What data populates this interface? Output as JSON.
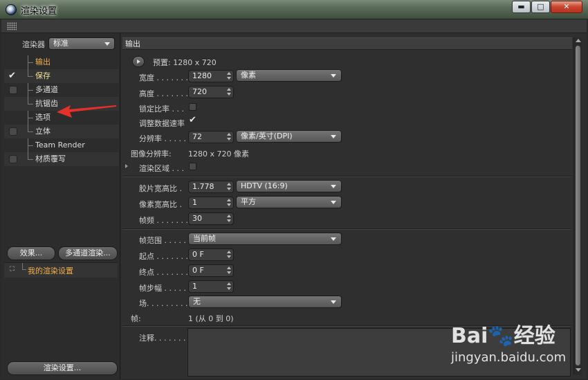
{
  "window": {
    "title": "渲染设置",
    "buttons": {
      "minimize": "▬",
      "maximize": "□",
      "close": "✕"
    }
  },
  "left": {
    "renderer_label": "渲染器",
    "renderer_value": "标准",
    "tree": [
      {
        "label": "输出",
        "checkbox": false,
        "checked": false,
        "active": true
      },
      {
        "label": "保存",
        "checkbox": true,
        "checked": true,
        "active": false
      },
      {
        "label": "多通道",
        "checkbox": true,
        "checked": false,
        "active": false
      },
      {
        "label": "抗锯齿",
        "checkbox": false,
        "checked": false,
        "active": false
      },
      {
        "label": "选项",
        "checkbox": false,
        "checked": false,
        "active": false
      },
      {
        "label": "立体",
        "checkbox": true,
        "checked": false,
        "active": false
      },
      {
        "label": "Team Render",
        "checkbox": false,
        "checked": false,
        "active": false
      },
      {
        "label": "材质覆写",
        "checkbox": true,
        "checked": false,
        "active": false
      }
    ],
    "effects_button": "效果...",
    "multipass_button": "多通道渲染...",
    "settings_item": "我的渲染设置",
    "render_settings_button": "渲染设置..."
  },
  "output": {
    "header": "输出",
    "preset": "预置: 1280 x 720",
    "width_label": "宽度 . . . . . . . .",
    "width_value": "1280",
    "unit_value": "像素",
    "height_label": "高度 . . . . . . . .",
    "height_value": "720",
    "lock_ratio_label": "锁定比率 . . .",
    "adapt_rate_label": "调整数据速率",
    "resolution_label": "分辨率 . . . . .",
    "resolution_value": "72",
    "resolution_unit": "像素/英寸(DPI)",
    "image_res_label": "图像分辨率:",
    "image_res_value": "1280 x 720 像素",
    "render_region_label": "渲染区域 . . .",
    "film_aspect_label": "胶片宽高比 .",
    "film_aspect_value": "1.778",
    "film_aspect_preset": "HDTV (16:9)",
    "pixel_aspect_label": "像素宽高比 .",
    "pixel_aspect_value": "1",
    "pixel_aspect_preset": "平方",
    "fps_label": "帧频 . . . . . . . .",
    "fps_value": "30",
    "frame_range_label": "帧范围 . . . . .",
    "frame_range_value": "当前帧",
    "start_label": "起点 . . . . . . . .",
    "start_value": "0 F",
    "end_label": "终点 . . . . . . . .",
    "end_value": "0 F",
    "step_label": "帧步幅 . . . . .",
    "step_value": "1",
    "field_label": "场. . . . . . . . . .",
    "field_value": "无",
    "frames_label": "帧:",
    "frames_value": "1 (从 0 到 0)",
    "notes_label": "注释. . . . . . ."
  },
  "watermark": {
    "logo": "Bai🐾经验",
    "url": "jingyan.baidu.com"
  },
  "colors": {
    "accent_orange": "#f2b04a",
    "arrow_red": "#e8302a"
  }
}
